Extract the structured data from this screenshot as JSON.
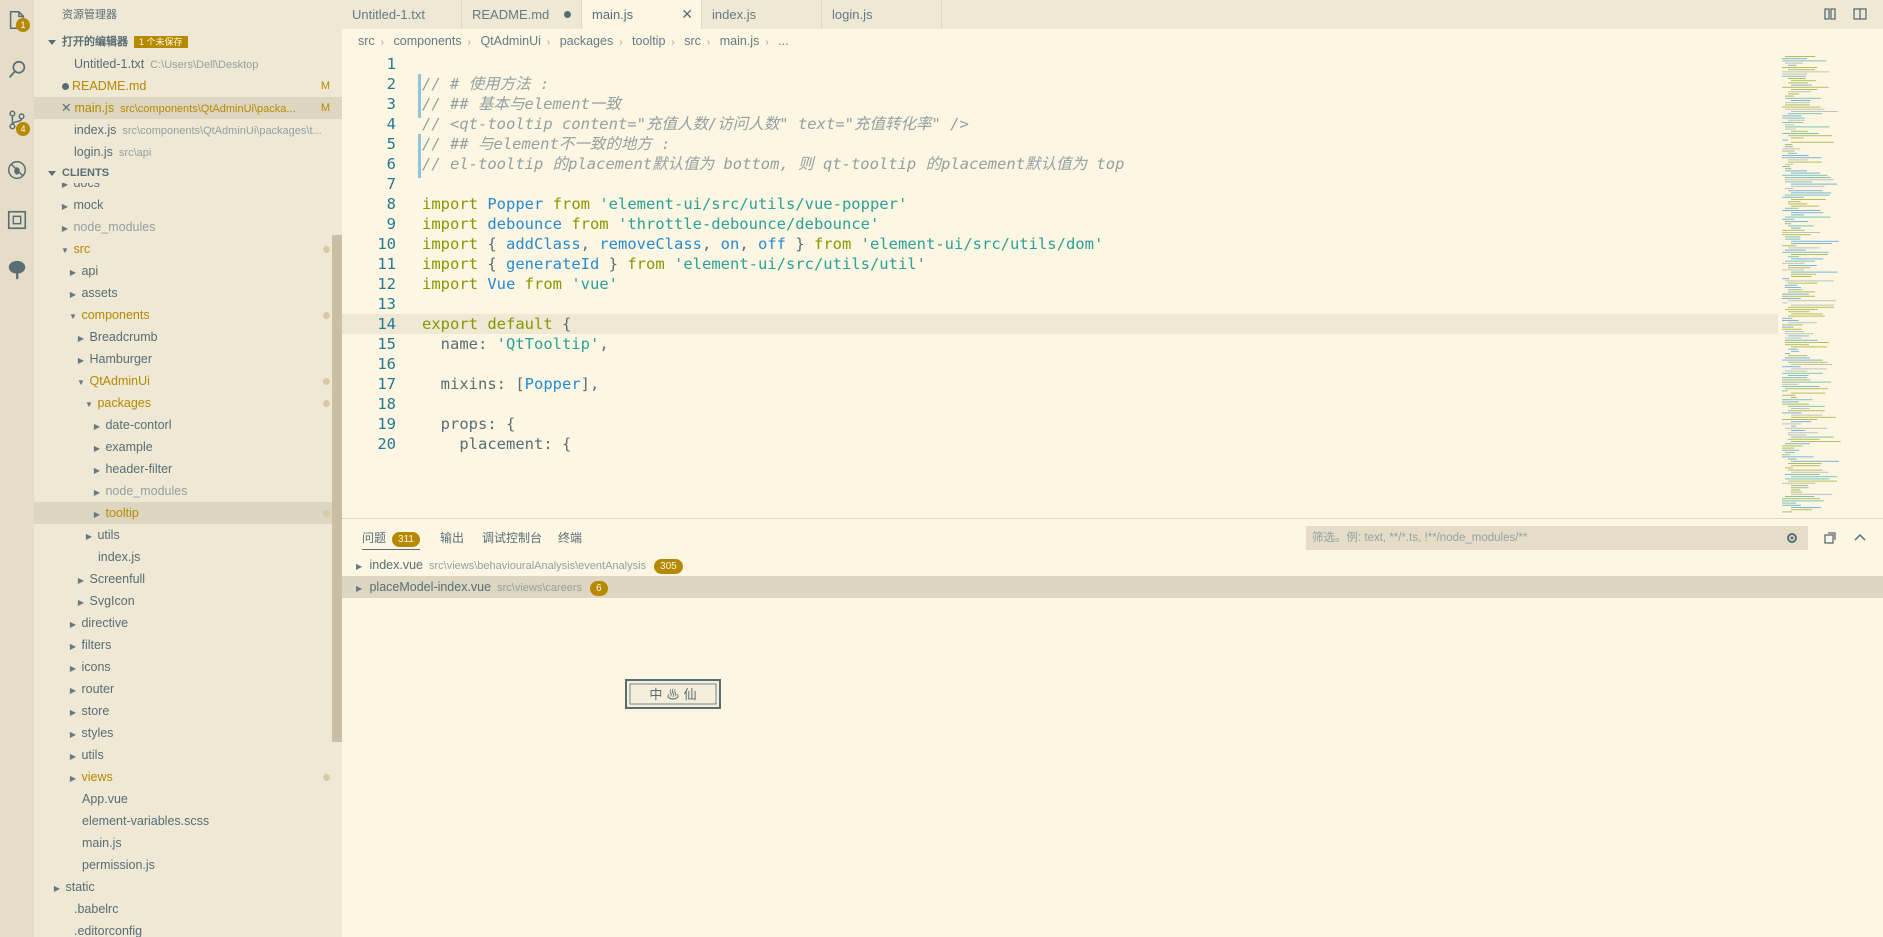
{
  "activity": {
    "explorer_badge": "1",
    "scm_badge": "4"
  },
  "sidebar": {
    "title": "资源管理器",
    "open_editors": {
      "header": "打开的编辑器",
      "unsaved_badge": "1 个未保存",
      "items": [
        {
          "name": "Untitled-1.txt",
          "path": "C:\\Users\\Dell\\Desktop",
          "mod": ""
        },
        {
          "name": "README.md",
          "path": "",
          "mod": "M"
        },
        {
          "name": "main.js",
          "path": "src\\components\\QtAdminUi\\packa...",
          "mod": "M"
        },
        {
          "name": "index.js",
          "path": "src\\components\\QtAdminUi\\packages\\t...",
          "mod": ""
        },
        {
          "name": "login.js",
          "path": "src\\api",
          "mod": ""
        }
      ]
    },
    "clients": {
      "header": "CLIENTS",
      "items": [
        {
          "label": "docs"
        },
        {
          "label": "mock"
        },
        {
          "label": "node_modules"
        },
        {
          "label": "src"
        },
        {
          "label": "api"
        },
        {
          "label": "assets"
        },
        {
          "label": "components"
        },
        {
          "label": "Breadcrumb"
        },
        {
          "label": "Hamburger"
        },
        {
          "label": "QtAdminUi"
        },
        {
          "label": "packages"
        },
        {
          "label": "date-contorl"
        },
        {
          "label": "example"
        },
        {
          "label": "header-filter"
        },
        {
          "label": "node_modules"
        },
        {
          "label": "tooltip"
        },
        {
          "label": "utils"
        },
        {
          "label": "index.js"
        },
        {
          "label": "Screenfull"
        },
        {
          "label": "SvgIcon"
        },
        {
          "label": "directive"
        },
        {
          "label": "filters"
        },
        {
          "label": "icons"
        },
        {
          "label": "router"
        },
        {
          "label": "store"
        },
        {
          "label": "styles"
        },
        {
          "label": "utils"
        },
        {
          "label": "views"
        },
        {
          "label": "App.vue"
        },
        {
          "label": "element-variables.scss"
        },
        {
          "label": "main.js"
        },
        {
          "label": "permission.js"
        },
        {
          "label": "static"
        },
        {
          "label": ".babelrc"
        },
        {
          "label": ".editorconfig"
        }
      ]
    }
  },
  "tabs": [
    {
      "label": "Untitled-1.txt"
    },
    {
      "label": "README.md"
    },
    {
      "label": "main.js"
    },
    {
      "label": "index.js"
    },
    {
      "label": "login.js"
    }
  ],
  "breadcrumb": [
    "src",
    "components",
    "QtAdminUi",
    "packages",
    "tooltip",
    "src",
    "main.js",
    "..."
  ],
  "editor": {
    "lines": [
      {
        "n": "1",
        "tokens": []
      },
      {
        "n": "2",
        "tokens": [
          {
            "c": "comment",
            "t": "// # 使用方法 :"
          }
        ]
      },
      {
        "n": "3",
        "tokens": [
          {
            "c": "comment",
            "t": "// ## 基本与element一致"
          }
        ]
      },
      {
        "n": "4",
        "tokens": [
          {
            "c": "comment",
            "t": "// <qt-tooltip content=\"充值人数/访问人数\" text=\"充值转化率\" />"
          }
        ]
      },
      {
        "n": "5",
        "tokens": [
          {
            "c": "comment",
            "t": "// ## 与element不一致的地方 :"
          }
        ]
      },
      {
        "n": "6",
        "tokens": [
          {
            "c": "comment",
            "t": "// el-tooltip 的placement默认值为 bottom, 则 qt-tooltip 的placement默认值为 top"
          }
        ]
      },
      {
        "n": "7",
        "tokens": []
      },
      {
        "n": "8",
        "tokens": [
          {
            "c": "kw",
            "t": "import "
          },
          {
            "c": "id",
            "t": "Popper"
          },
          {
            "c": "kw",
            "t": " from "
          },
          {
            "c": "str",
            "t": "'element-ui/src/utils/vue-popper'"
          }
        ]
      },
      {
        "n": "9",
        "tokens": [
          {
            "c": "kw",
            "t": "import "
          },
          {
            "c": "id",
            "t": "debounce"
          },
          {
            "c": "kw",
            "t": " from "
          },
          {
            "c": "str",
            "t": "'throttle-debounce/debounce'"
          }
        ]
      },
      {
        "n": "10",
        "tokens": [
          {
            "c": "kw",
            "t": "import "
          },
          {
            "c": "plain",
            "t": "{ "
          },
          {
            "c": "id",
            "t": "addClass"
          },
          {
            "c": "plain",
            "t": ", "
          },
          {
            "c": "id",
            "t": "removeClass"
          },
          {
            "c": "plain",
            "t": ", "
          },
          {
            "c": "id",
            "t": "on"
          },
          {
            "c": "plain",
            "t": ", "
          },
          {
            "c": "id",
            "t": "off"
          },
          {
            "c": "plain",
            "t": " } "
          },
          {
            "c": "kw",
            "t": "from "
          },
          {
            "c": "str",
            "t": "'element-ui/src/utils/dom'"
          }
        ]
      },
      {
        "n": "11",
        "tokens": [
          {
            "c": "kw",
            "t": "import "
          },
          {
            "c": "plain",
            "t": "{ "
          },
          {
            "c": "id",
            "t": "generateId"
          },
          {
            "c": "plain",
            "t": " } "
          },
          {
            "c": "kw",
            "t": "from "
          },
          {
            "c": "str",
            "t": "'element-ui/src/utils/util'"
          }
        ]
      },
      {
        "n": "12",
        "tokens": [
          {
            "c": "kw",
            "t": "import "
          },
          {
            "c": "id",
            "t": "Vue"
          },
          {
            "c": "kw",
            "t": " from "
          },
          {
            "c": "str",
            "t": "'vue'"
          }
        ]
      },
      {
        "n": "13",
        "tokens": []
      },
      {
        "n": "14",
        "tokens": [
          {
            "c": "kw",
            "t": "export default "
          },
          {
            "c": "plain",
            "t": "{"
          }
        ]
      },
      {
        "n": "15",
        "tokens": [
          {
            "c": "plain",
            "t": "  name: "
          },
          {
            "c": "str",
            "t": "'QtTooltip'"
          },
          {
            "c": "plain",
            "t": ","
          }
        ]
      },
      {
        "n": "16",
        "tokens": []
      },
      {
        "n": "17",
        "tokens": [
          {
            "c": "plain",
            "t": "  mixins: ["
          },
          {
            "c": "id",
            "t": "Popper"
          },
          {
            "c": "plain",
            "t": "],"
          }
        ]
      },
      {
        "n": "18",
        "tokens": []
      },
      {
        "n": "19",
        "tokens": [
          {
            "c": "plain",
            "t": "  props: {"
          }
        ]
      },
      {
        "n": "20",
        "tokens": [
          {
            "c": "plain",
            "t": "    placement: {"
          }
        ]
      }
    ]
  },
  "panel": {
    "tabs": [
      {
        "label": "问题",
        "badge": "311"
      },
      {
        "label": "输出"
      },
      {
        "label": "调试控制台"
      },
      {
        "label": "终端"
      }
    ],
    "filter_placeholder": "筛选。例: text, **/*.ts, !**/node_modules/**",
    "problems": [
      {
        "file": "index.vue",
        "path": "src\\views\\behaviouralAnalysis\\eventAnalysis",
        "count": "305"
      },
      {
        "file": "placeModel-index.vue",
        "path": "src\\views\\careers",
        "count": "6"
      }
    ]
  },
  "seal": {
    "text": "中 ♨ 仙"
  },
  "colors": {
    "background": "#fdf6e3",
    "sidebar": "#eee8d5",
    "accent": "#b58900",
    "keyword": "#859900",
    "identifier": "#268bd2",
    "string": "#2aa198",
    "comment": "#93a1a1"
  }
}
